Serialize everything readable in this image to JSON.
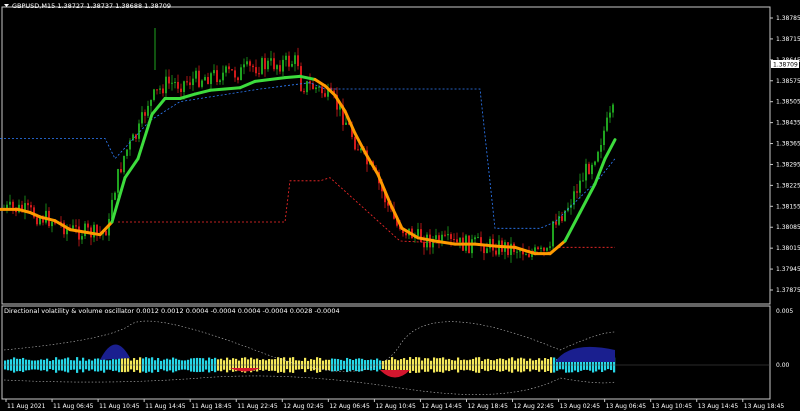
{
  "window": {
    "title": "GBPUSD,M15  1.38727 1.38737 1.38688 1.38709",
    "current_price": "1.38709"
  },
  "indicator": {
    "title": "Directional volatility & volume oscillator 0.0012 0.0012 0.0004 -0.0004 0.0004 -0.0004 0.0028 -0.0004",
    "levels": [
      "0.005",
      "0.00"
    ]
  },
  "colors": {
    "background": "#000000",
    "bull_candle": "#1fa41f",
    "bear_candle": "#d21a1a",
    "trend_up": "#3ddc3d",
    "trend_down": "#ff9a00",
    "upper_band": "#2f7fff",
    "lower_band": "#ff2a2a",
    "osc_cyan": "#26d7e8",
    "osc_yellow": "#f5e95a",
    "osc_navy": "#1a1f8f",
    "osc_red": "#d3162e"
  },
  "chart_data": {
    "type": "candlestick",
    "symbol": "GBPUSD",
    "timeframe": "M15",
    "y_ticks": [
      "1.38785",
      "1.38715",
      "1.38645",
      "1.38575",
      "1.38505",
      "1.38435",
      "1.38365",
      "1.38295",
      "1.38225",
      "1.38155",
      "1.38085",
      "1.38015",
      "1.37945",
      "1.37875"
    ],
    "x_ticks": [
      "11 Aug 2021",
      "11 Aug 06:45",
      "11 Aug 10:45",
      "11 Aug 14:45",
      "11 Aug 18:45",
      "11 Aug 22:45",
      "12 Aug 02:45",
      "12 Aug 06:45",
      "12 Aug 10:45",
      "12 Aug 14:45",
      "12 Aug 18:45",
      "12 Aug 22:45",
      "13 Aug 02:45",
      "13 Aug 06:45",
      "13 Aug 10:45",
      "13 Aug 14:45",
      "13 Aug 18:45"
    ],
    "ylim": [
      1.37845,
      1.38835
    ],
    "trend_line": [
      [
        0,
        1.835
      ],
      [
        18,
        1.835
      ],
      [
        30,
        1.8345
      ],
      [
        40,
        1.8338
      ],
      [
        55,
        1.8332
      ],
      [
        70,
        1.8318
      ],
      [
        85,
        1.8314
      ],
      [
        100,
        1.831
      ],
      [
        112,
        1.833
      ],
      [
        125,
        1.84
      ],
      [
        138,
        1.843
      ],
      [
        152,
        1.85
      ],
      [
        165,
        1.8525
      ],
      [
        180,
        1.8525
      ],
      [
        195,
        1.8532
      ],
      [
        210,
        1.8538
      ],
      [
        225,
        1.854
      ],
      [
        240,
        1.8542
      ],
      [
        255,
        1.8552
      ],
      [
        270,
        1.8555
      ],
      [
        285,
        1.8558
      ],
      [
        300,
        1.856
      ],
      [
        315,
        1.8555
      ],
      [
        325,
        1.8545
      ],
      [
        335,
        1.853
      ],
      [
        345,
        1.8505
      ],
      [
        355,
        1.847
      ],
      [
        365,
        1.844
      ],
      [
        378,
        1.8405
      ],
      [
        390,
        1.836
      ],
      [
        402,
        1.832
      ],
      [
        418,
        1.8305
      ],
      [
        435,
        1.83
      ],
      [
        455,
        1.8295
      ],
      [
        475,
        1.8295
      ],
      [
        495,
        1.8292
      ],
      [
        515,
        1.829
      ],
      [
        535,
        1.828
      ],
      [
        550,
        1.828
      ],
      [
        565,
        1.83
      ],
      [
        580,
        1.8345
      ],
      [
        595,
        1.839
      ],
      [
        605,
        1.843
      ],
      [
        615,
        1.846
      ]
    ],
    "upper_band": [
      [
        0,
        1.8462
      ],
      [
        105,
        1.8462
      ],
      [
        115,
        1.843
      ],
      [
        150,
        1.849
      ],
      [
        180,
        1.852
      ],
      [
        260,
        1.854
      ],
      [
        310,
        1.855
      ],
      [
        325,
        1.854
      ],
      [
        480,
        1.854
      ],
      [
        495,
        1.832
      ],
      [
        540,
        1.832
      ],
      [
        555,
        1.833
      ],
      [
        600,
        1.84
      ],
      [
        615,
        1.843
      ]
    ],
    "lower_band": [
      [
        118,
        1.833
      ],
      [
        285,
        1.833
      ],
      [
        290,
        1.8395
      ],
      [
        320,
        1.8395
      ],
      [
        330,
        1.84
      ],
      [
        400,
        1.83
      ],
      [
        500,
        1.8292
      ],
      [
        520,
        1.8288
      ],
      [
        545,
        1.828
      ],
      [
        560,
        1.829
      ],
      [
        615,
        1.829
      ]
    ]
  }
}
